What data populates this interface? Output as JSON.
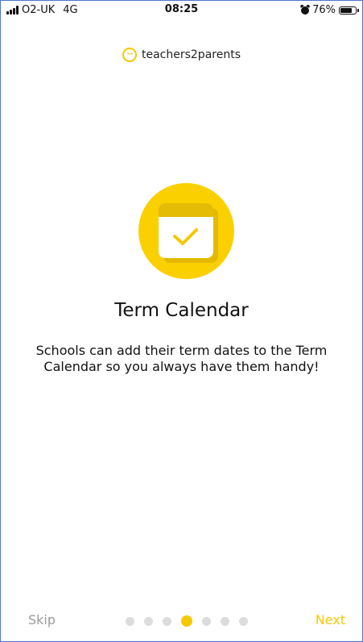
{
  "status_bar": {
    "carrier": "O2-UK",
    "network": "4G",
    "time": "08:25",
    "battery": "76%",
    "battery_level": 0.76
  },
  "brand": {
    "name": "teachers2parents",
    "icon": "chat-bubble-dots-icon"
  },
  "onboarding": {
    "icon": "calendar-check-icon",
    "title": "Term Calendar",
    "description": "Schools can add their term dates to the Term Calendar so you always have them handy!"
  },
  "navigation": {
    "skip_label": "Skip",
    "next_label": "Next",
    "page_count": 7,
    "active_page": 4
  },
  "colors": {
    "accent": "#f6c800",
    "hero_circle": "#fbd000",
    "inactive_dot": "#dcdcdc",
    "skip_text": "#9b9b9b"
  }
}
